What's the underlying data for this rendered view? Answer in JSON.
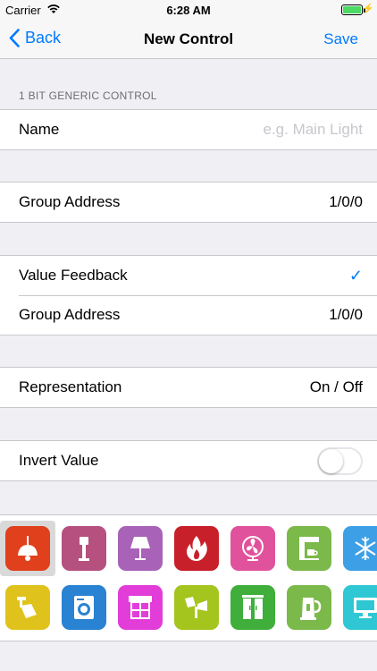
{
  "status_bar": {
    "carrier": "Carrier",
    "time": "6:28 AM"
  },
  "nav": {
    "back_label": "Back",
    "title": "New Control",
    "save_label": "Save"
  },
  "section": {
    "header": "1 BIT GENERIC CONTROL"
  },
  "name_row": {
    "label": "Name",
    "placeholder": "e.g. Main Light"
  },
  "group_address_row": {
    "label": "Group Address",
    "value": "1/0/0"
  },
  "value_feedback": {
    "label": "Value Feedback",
    "checked": true,
    "group_address_label": "Group Address",
    "group_address_value": "1/0/0"
  },
  "representation_row": {
    "label": "Representation",
    "value": "On / Off"
  },
  "invert_row": {
    "label": "Invert Value",
    "enabled": false
  },
  "icons": {
    "selected_index": 0,
    "items": [
      {
        "name": "ceiling-lamp-icon",
        "color": "#e0401c"
      },
      {
        "name": "street-lamp-icon",
        "color": "#b5507f"
      },
      {
        "name": "table-lamp-icon",
        "color": "#a862b8"
      },
      {
        "name": "fire-icon",
        "color": "#c8202a"
      },
      {
        "name": "fan-icon",
        "color": "#e0529b"
      },
      {
        "name": "coffee-machine-icon",
        "color": "#7bb94a"
      },
      {
        "name": "snowflake-icon",
        "color": "#3da0e6"
      },
      {
        "name": "spotlight-icon",
        "color": "#e0c21c"
      },
      {
        "name": "washing-machine-icon",
        "color": "#2a82d3"
      },
      {
        "name": "awning-window-icon",
        "color": "#e23dd8"
      },
      {
        "name": "wall-spotlight-icon",
        "color": "#a4c41e"
      },
      {
        "name": "wardrobe-icon",
        "color": "#3fae3a"
      },
      {
        "name": "kettle-icon",
        "color": "#7bb94a"
      },
      {
        "name": "tv-icon",
        "color": "#2ec7d3"
      }
    ]
  }
}
